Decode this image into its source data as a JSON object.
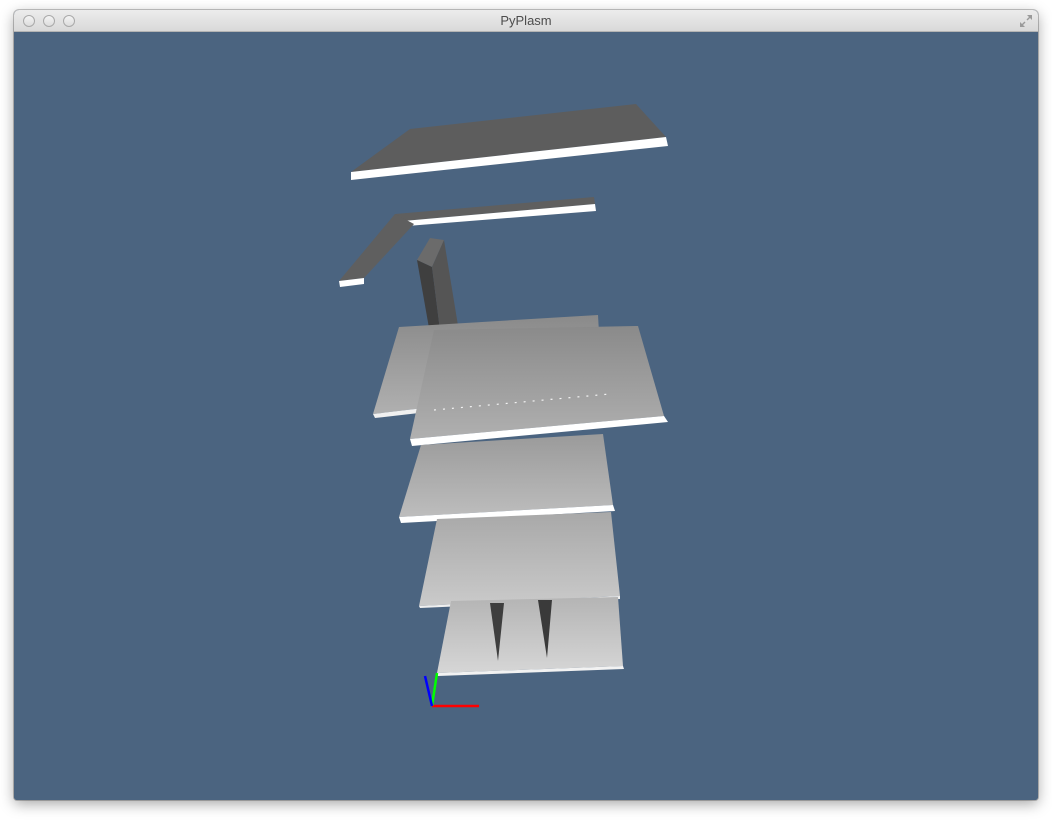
{
  "window": {
    "title": "PyPlasm",
    "controls": [
      "close-button",
      "minimize-button",
      "zoom-button"
    ],
    "fullscreen_icon": "fullscreen-arrows-icon"
  },
  "viewport": {
    "background_color": "#4b6480",
    "scene": "3d-building-exploded-floors",
    "axes": {
      "x_color": "#ff0000",
      "y_color": "#00ff00",
      "z_color": "#0000ff"
    }
  }
}
